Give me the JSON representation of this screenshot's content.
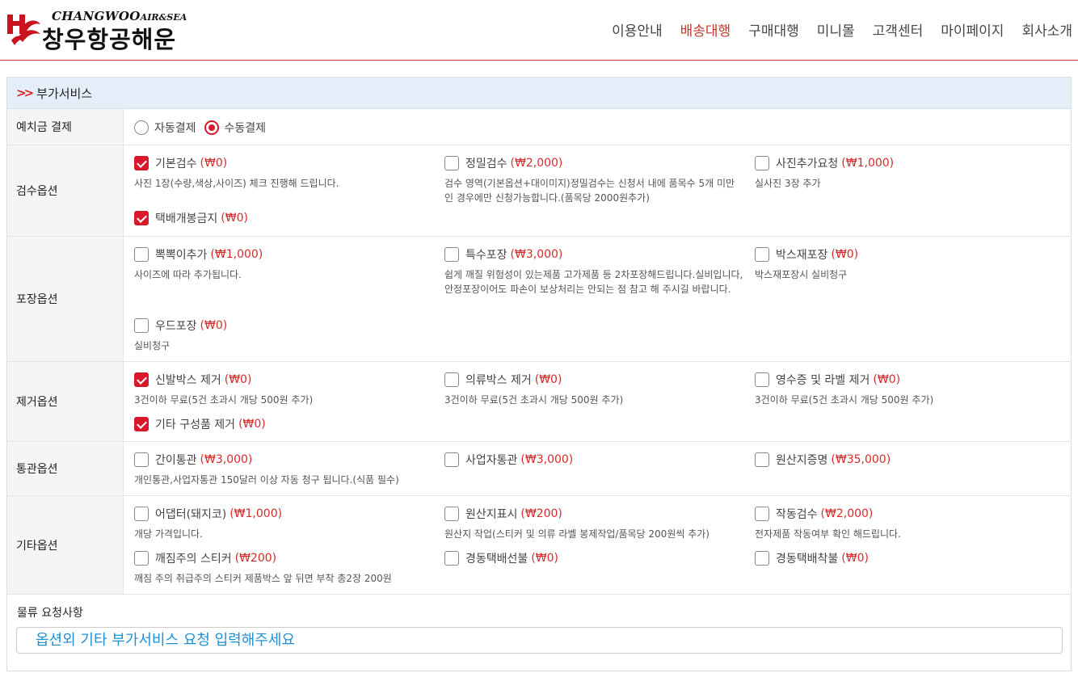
{
  "brand": {
    "en_main": "CHANGWOO",
    "en_sub": "AIR&SEA",
    "ko": "창우항공해운"
  },
  "nav": [
    {
      "label": "이용안내",
      "active": false
    },
    {
      "label": "배송대행",
      "active": true
    },
    {
      "label": "구매대행",
      "active": false
    },
    {
      "label": "미니몰",
      "active": false
    },
    {
      "label": "고객센터",
      "active": false
    },
    {
      "label": "마이페이지",
      "active": false
    },
    {
      "label": "회사소개",
      "active": false
    }
  ],
  "section": {
    "title": "부가서비스"
  },
  "deposit": {
    "label": "예치금 결제",
    "options": [
      {
        "label": "자동결제",
        "selected": false
      },
      {
        "label": "수동결제",
        "selected": true
      }
    ]
  },
  "groups": {
    "inspection": {
      "label": "검수옵션",
      "options": [
        {
          "label": "기본검수",
          "price": "(₩0)",
          "checked": true,
          "desc": "사진 1장(수량,색상,사이즈) 체크 진행해 드립니다."
        },
        {
          "label": "정밀검수",
          "price": "(₩2,000)",
          "checked": false,
          "desc": "검수 영역(기본옵션+대이미지)정밀검수는 신청서 내에 품목수 5개 미만인 경우에만 신청가능합니다.(품목당 2000원추가)"
        },
        {
          "label": "사진추가요청",
          "price": "(₩1,000)",
          "checked": false,
          "desc": "실사진 3장 추가"
        },
        {
          "label": "택배개봉금지",
          "price": "(₩0)",
          "checked": true,
          "desc": ""
        }
      ]
    },
    "packing": {
      "label": "포장옵션",
      "options": [
        {
          "label": "뽁뽁이추가",
          "price": "(₩1,000)",
          "checked": false,
          "desc": "사이즈에 따라 추가됩니다."
        },
        {
          "label": "특수포장",
          "price": "(₩3,000)",
          "checked": false,
          "desc": "쉽게 깨질 위험성이 있는제품 고가제품 등 2차포장해드립니다.실비입니다,안정포장이어도 파손이 보상처리는 안되는 점 참고 해 주시길 바랍니다."
        },
        {
          "label": "박스재포장",
          "price": "(₩0)",
          "checked": false,
          "desc": "박스재포장시 실비청구"
        },
        {
          "label": "우드포장",
          "price": "(₩0)",
          "checked": false,
          "desc": "실비청구"
        }
      ]
    },
    "removal": {
      "label": "제거옵션",
      "options": [
        {
          "label": "신발박스 제거",
          "price": "(₩0)",
          "checked": true,
          "desc": "3건이하 무료(5건 초과시 개당 500원 추가)"
        },
        {
          "label": "의류박스 제거",
          "price": "(₩0)",
          "checked": false,
          "desc": "3건이하 무료(5건 초과시 개당 500원 추가)"
        },
        {
          "label": "영수증 및 라벨 제거",
          "price": "(₩0)",
          "checked": false,
          "desc": "3건이하 무료(5건 초과시 개당 500원 추가)"
        },
        {
          "label": "기타 구성품 제거",
          "price": "(₩0)",
          "checked": true,
          "desc": ""
        }
      ]
    },
    "customs": {
      "label": "통관옵션",
      "options": [
        {
          "label": "간이통관",
          "price": "(₩3,000)",
          "checked": false,
          "desc": "개인통관,사업자통관 150달러 이상 자동 청구 됩니다.(식품 필수)"
        },
        {
          "label": "사업자통관",
          "price": "(₩3,000)",
          "checked": false,
          "desc": ""
        },
        {
          "label": "원산지증명",
          "price": "(₩35,000)",
          "checked": false,
          "desc": ""
        }
      ]
    },
    "other": {
      "label": "기타옵션",
      "options": [
        {
          "label": "어댑터(돼지코)",
          "price": "(₩1,000)",
          "checked": false,
          "desc": "개당 가격입니다."
        },
        {
          "label": "원산지표시",
          "price": "(₩200)",
          "checked": false,
          "desc": "원산지 작업(스티커 및 의류 라벨 봉제작업/품목당 200원씩 추가)"
        },
        {
          "label": "작동검수",
          "price": "(₩2,000)",
          "checked": false,
          "desc": "전자제품 작동여부 확인 해드립니다."
        },
        {
          "label": "깨짐주의 스티커",
          "price": "(₩200)",
          "checked": false,
          "desc": "깨짐 주의 취급주의 스티커 제품박스 앞 뒤면 부착 총2장 200원"
        },
        {
          "label": "경동택배선불",
          "price": "(₩0)",
          "checked": false,
          "desc": ""
        },
        {
          "label": "경동택배착불",
          "price": "(₩0)",
          "checked": false,
          "desc": ""
        }
      ]
    }
  },
  "request": {
    "label": "물류 요청사항",
    "placeholder": "옵션외 기타 부가서비스 요청 입력해주세요"
  }
}
